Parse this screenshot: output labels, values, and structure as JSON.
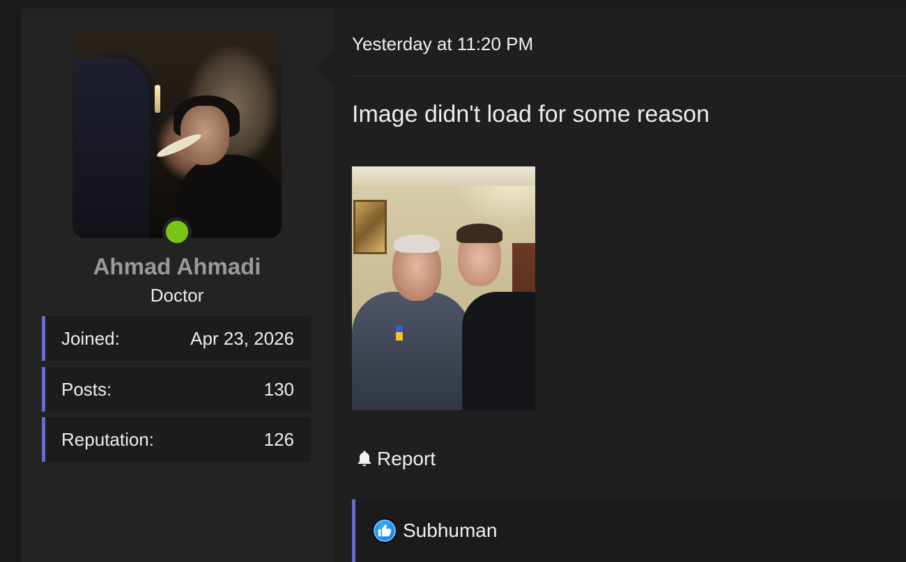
{
  "user": {
    "name": "Ahmad Ahmadi",
    "title": "Doctor",
    "online": true,
    "stats": [
      {
        "label": "Joined:",
        "value": "Apr 23, 2026"
      },
      {
        "label": "Posts:",
        "value": "130"
      },
      {
        "label": "Reputation:",
        "value": "126"
      }
    ]
  },
  "post": {
    "date": "Yesterday at 11:20 PM",
    "text": "Image didn't load for some reason",
    "report_label": "Report",
    "reaction_label": "Subhuman"
  },
  "colors": {
    "accent": "#6a6bc8",
    "online": "#7cc416",
    "like": "#1a8cf0"
  },
  "icons": [
    "bell-icon",
    "thumbs-up-icon"
  ]
}
